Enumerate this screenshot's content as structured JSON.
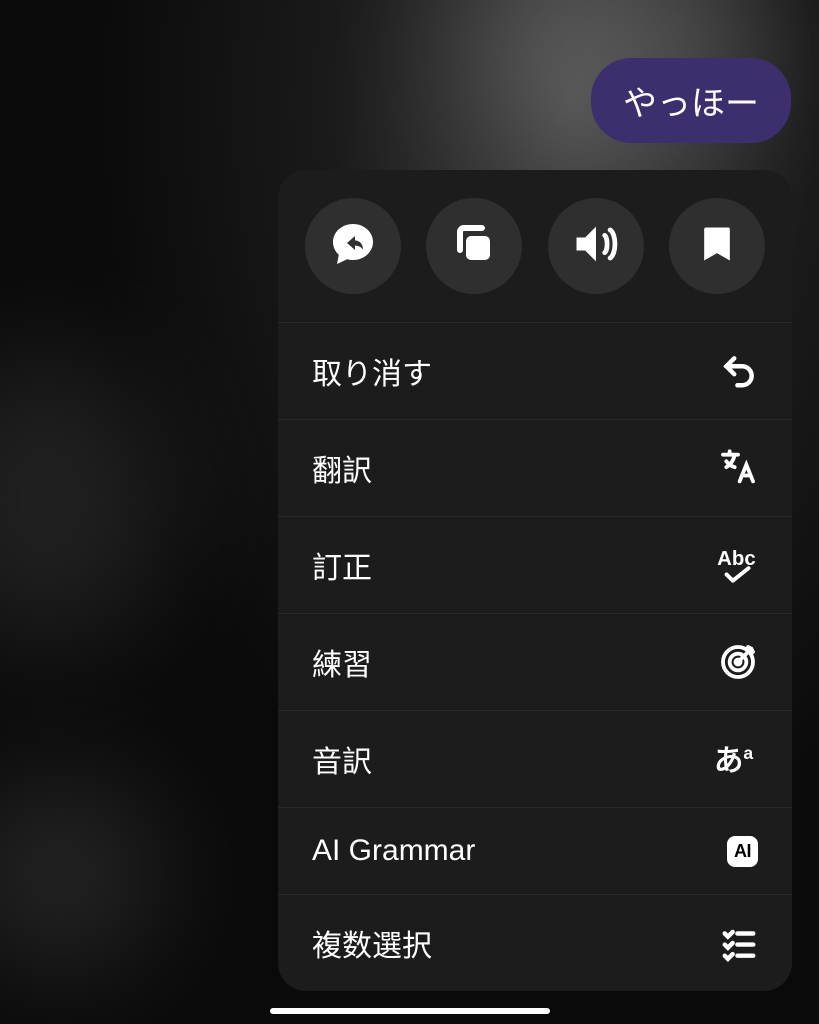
{
  "chat": {
    "message": "やっほー"
  },
  "menu": {
    "topActions": [
      {
        "name": "reply-icon"
      },
      {
        "name": "copy-icon"
      },
      {
        "name": "speaker-icon"
      },
      {
        "name": "bookmark-icon"
      }
    ],
    "items": [
      {
        "label": "取り消す",
        "icon": "undo-icon"
      },
      {
        "label": "翻訳",
        "icon": "translate-icon"
      },
      {
        "label": "訂正",
        "icon": "spellcheck-icon"
      },
      {
        "label": "練習",
        "icon": "target-icon"
      },
      {
        "label": "音訳",
        "icon": "transliterate-icon"
      },
      {
        "label": "AI Grammar",
        "icon": "ai-badge-icon"
      },
      {
        "label": "複数選択",
        "icon": "checklist-icon"
      }
    ]
  },
  "colors": {
    "bubble": "#3d2f6e",
    "menuBg": "#1c1c1c",
    "iconBg": "#2f2f2f"
  }
}
